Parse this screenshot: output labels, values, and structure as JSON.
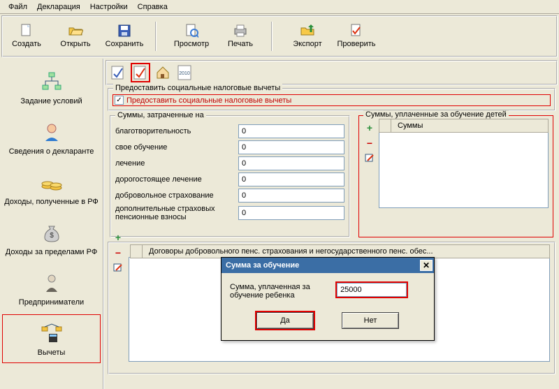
{
  "menu": {
    "file": "Файл",
    "declaration": "Декларация",
    "settings": "Настройки",
    "help": "Справка"
  },
  "toolbar": {
    "create": "Создать",
    "open": "Открыть",
    "save": "Сохранить",
    "preview": "Просмотр",
    "print": "Печать",
    "export": "Экспорт",
    "check": "Проверить"
  },
  "sidebar": {
    "items": [
      "Задание условий",
      "Сведения о декларанте",
      "Доходы, полученные в РФ",
      "Доходы за пределами РФ",
      "Предприниматели",
      "Вычеты"
    ]
  },
  "tabicons": {
    "year": "2010"
  },
  "main": {
    "grant_group": "Предоставить социальные налоговые вычеты",
    "grant_chk": "Предоставить социальные налоговые вычеты",
    "spent_group": "Суммы, затраченные на",
    "labels": {
      "charity": "благотворительность",
      "own_edu": "свое обучение",
      "treatment": "лечение",
      "expensive_treatment": "дорогостоящее лечение",
      "insurance": "добровольное страхование",
      "pension": "дополнительные страховых пенсионные взносы"
    },
    "values": {
      "charity": "0",
      "own_edu": "0",
      "treatment": "0",
      "expensive_treatment": "0",
      "insurance": "0",
      "pension": "0"
    },
    "children_edu_group": "Суммы, уплаченные за обучение детей",
    "sums_col": "Суммы",
    "contracts_group": "Договоры добровольного пенс. страхования и негосударственного пенс. обес..."
  },
  "dialog": {
    "title": "Сумма за обучение",
    "label": "Сумма, уплаченная за обучение ребенка",
    "value": "25000",
    "ok": "Да",
    "cancel": "Нет"
  }
}
